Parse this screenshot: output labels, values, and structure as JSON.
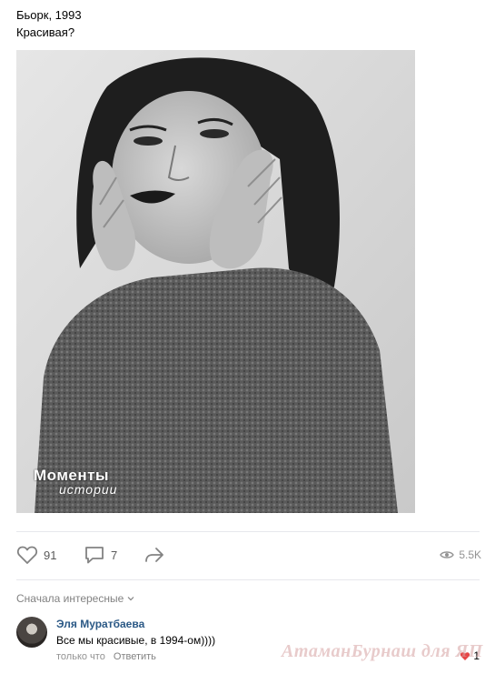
{
  "post": {
    "line1": "Бьорк, 1993",
    "line2": "Красивая?"
  },
  "photo": {
    "watermark_title": "Моменты",
    "watermark_subtitle": "истории"
  },
  "actions": {
    "likes": "91",
    "comments": "7",
    "views": "5.5K"
  },
  "comments_section": {
    "sort_label": "Сначала интересные",
    "comment": {
      "author": "Эля Муратбаева",
      "text": "Все мы красивые, в 1994-ом))))",
      "time": "только что",
      "reply_label": "Ответить",
      "likes": "1"
    }
  },
  "site_watermark": "АтаманБурнаш для ЯП",
  "colors": {
    "link": "#2a5885",
    "muted": "#828282",
    "divider": "#e7e8ec",
    "like_active": "#e64646"
  }
}
